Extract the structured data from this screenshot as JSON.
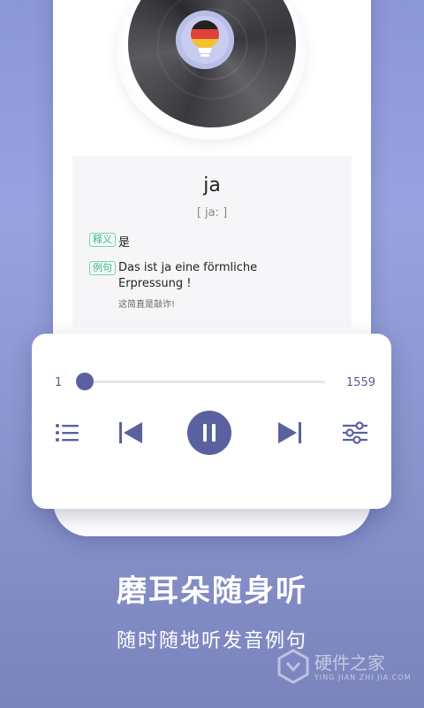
{
  "word_card": {
    "word": "ja",
    "phonetic": "[ ja: ]",
    "meaning_tag": "释义",
    "meaning": "是",
    "example_tag": "例句",
    "example": "Das ist ja eine förmliche Erpressung !",
    "translation": "这简直是敲诈!"
  },
  "player": {
    "current": "1",
    "total": "1559",
    "progress_fraction": 0.0,
    "accent": "#5a61a0"
  },
  "promo": {
    "headline": "磨耳朵随身听",
    "subline": "随时随地听发音例句"
  },
  "watermark": {
    "name": "硬件之家",
    "sub": "YING JIAN ZHI JIA.COM"
  }
}
